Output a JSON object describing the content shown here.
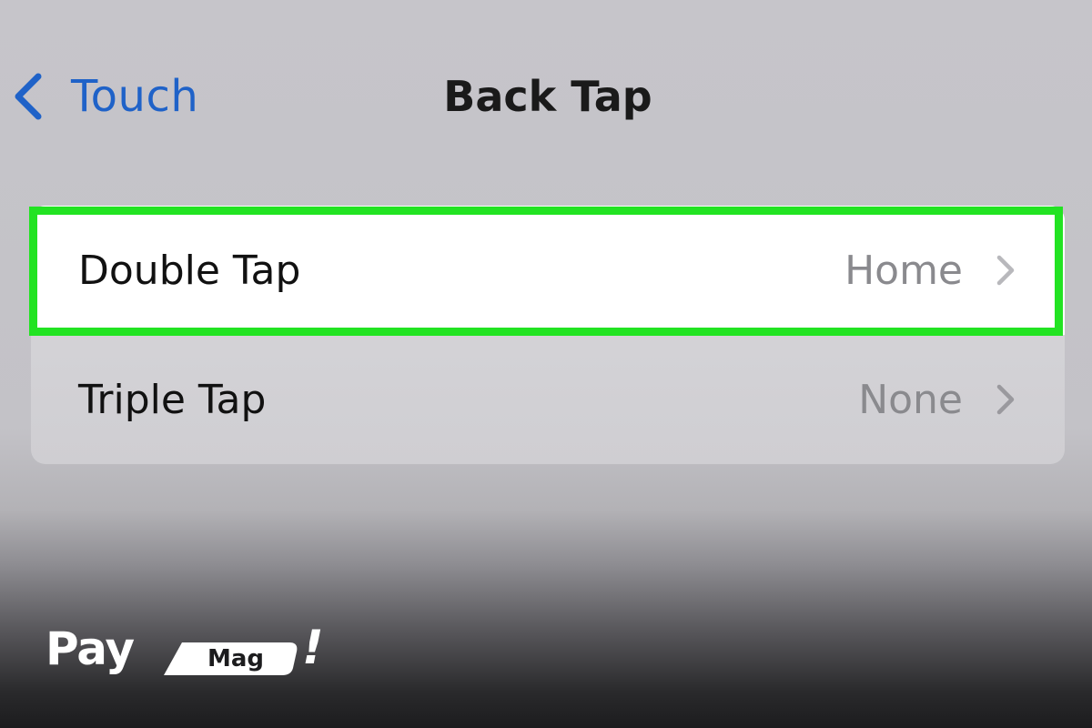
{
  "nav": {
    "back_label": "Touch",
    "back_icon": "chevron-left-icon",
    "title": "Back Tap"
  },
  "rows": [
    {
      "label": "Double Tap",
      "value": "Home",
      "chevron_icon": "chevron-right-icon",
      "highlighted": true
    },
    {
      "label": "Triple Tap",
      "value": "None",
      "chevron_icon": "chevron-right-icon",
      "highlighted": false
    }
  ],
  "logo": {
    "pay": "Pay",
    "mag": "Mag",
    "exclamation": "!"
  },
  "colors": {
    "accent_blue": "#1f62c8",
    "highlight_green": "#22e322",
    "secondary_text": "#8a8a8e"
  }
}
